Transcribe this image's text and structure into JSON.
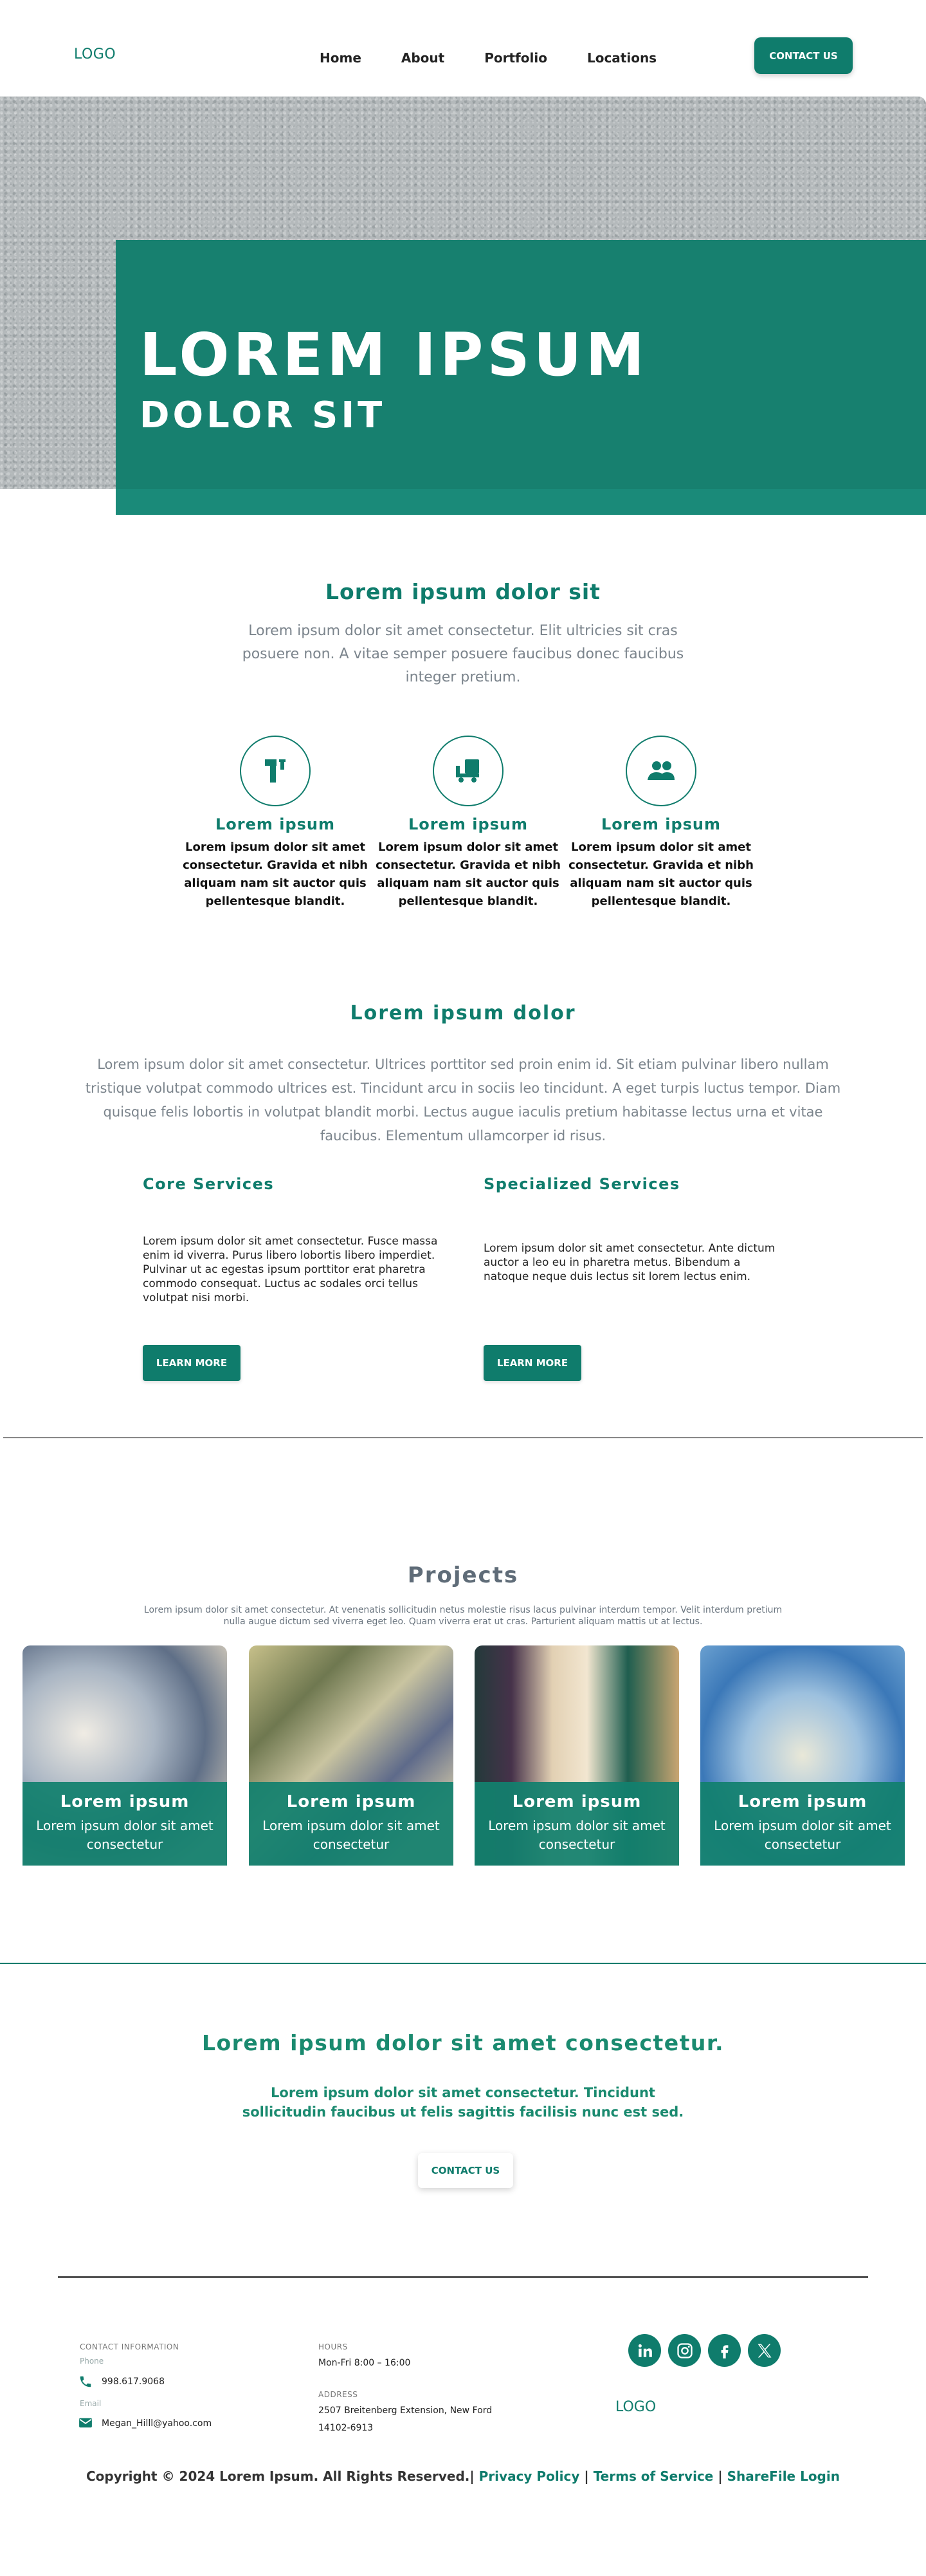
{
  "header": {
    "logo": "LOGO",
    "nav": [
      "Home",
      "About",
      "Portfolio",
      "Locations"
    ],
    "contact_btn": "CONTACT US"
  },
  "hero": {
    "title": "LOREM IPSUM",
    "subtitle": "DOLOR SIT"
  },
  "intro": {
    "title": "Lorem ipsum dolor sit",
    "text": "Lorem ipsum dolor sit amet consectetur. Elit ultricies sit cras posuere non. A vitae semper posuere faucibus donec faucibus integer pretium."
  },
  "features": [
    {
      "icon": "tools-icon",
      "title": "Lorem ipsum",
      "text": "Lorem ipsum dolor sit amet consectetur. Gravida et nibh aliquam nam sit auctor quis pellentesque blandit."
    },
    {
      "icon": "delivery-truck-icon",
      "title": "Lorem ipsum",
      "text": "Lorem ipsum dolor sit amet consectetur. Gravida et nibh aliquam nam sit auctor quis pellentesque blandit."
    },
    {
      "icon": "people-icon",
      "title": "Lorem ipsum",
      "text": "Lorem ipsum dolor sit amet consectetur. Gravida et nibh aliquam nam sit auctor quis pellentesque blandit."
    }
  ],
  "services": {
    "title": "Lorem ipsum dolor",
    "text": "Lorem ipsum dolor sit amet consectetur. Ultrices porttitor sed proin enim id. Sit etiam pulvinar libero nullam tristique volutpat commodo ultrices est. Tincidunt arcu in sociis leo tincidunt. A eget turpis luctus tempor. Diam quisque felis lobortis in volutpat blandit morbi. Lectus augue iaculis pretium habitasse lectus urna et vitae faucibus. Elementum ullamcorper id risus.",
    "columns": [
      {
        "title": "Core Services",
        "text": "Lorem ipsum dolor sit amet consectetur. Fusce massa enim id viverra. Purus libero lobortis libero imperdiet. Pulvinar ut ac egestas ipsum porttitor erat pharetra commodo consequat. Luctus ac sodales orci tellus volutpat nisi morbi.",
        "button": "LEARN MORE"
      },
      {
        "title": "Specialized Services",
        "text": "Lorem ipsum dolor sit amet consectetur. Ante dictum auctor a leo eu in pharetra metus. Bibendum a natoque neque duis lectus sit lorem lectus enim.",
        "button": "LEARN MORE"
      }
    ]
  },
  "projects": {
    "title": "Projects",
    "text": "Lorem ipsum dolor sit amet consectetur. At venenatis sollicitudin netus molestie risus lacus pulvinar interdum tempor. Velit interdum pretium nulla augue dictum sed viverra eget leo. Quam viverra erat ut cras. Parturient aliquam mattis ut at lectus.",
    "cards": [
      {
        "title": "Lorem ipsum",
        "text": "Lorem ipsum dolor sit amet consectetur"
      },
      {
        "title": "Lorem ipsum",
        "text": "Lorem ipsum dolor sit amet consectetur"
      },
      {
        "title": "Lorem ipsum",
        "text": "Lorem ipsum dolor sit amet consectetur"
      },
      {
        "title": "Lorem ipsum",
        "text": "Lorem ipsum dolor sit amet consectetur"
      }
    ]
  },
  "cta": {
    "title": "Lorem ipsum dolor sit amet consectetur.",
    "text": "Lorem ipsum dolor sit amet consectetur. Tincidunt sollicitudin faucibus ut felis sagittis facilisis nunc est sed.",
    "button": "CONTACT US"
  },
  "footer": {
    "contact_label": "CONTACT INFORMATION",
    "phone_label": "Phone",
    "phone": "998.617.9068",
    "email_label": "Email",
    "email": "Megan_Hilll@yahoo.com",
    "hours_label": "HOURS",
    "hours": "Mon-Fri 8:00 – 16:00",
    "address_label": "ADDRESS",
    "address_line1": "2507 Breitenberg Extension, New Ford",
    "address_line2": "14102-6913",
    "social": [
      "linkedin-icon",
      "instagram-icon",
      "facebook-icon",
      "x-icon"
    ],
    "logo": "LOGO",
    "copyright": "Copyright © 2024 Lorem Ipsum. All Rights Reserved.|",
    "links": [
      "Privacy Policy",
      "Terms of Service",
      "ShareFile Login"
    ],
    "separators": [
      "|",
      "|"
    ]
  },
  "colors": {
    "accent": "#0f7c6c",
    "hero_box": "#17806f",
    "muted_text": "#7b848c"
  }
}
